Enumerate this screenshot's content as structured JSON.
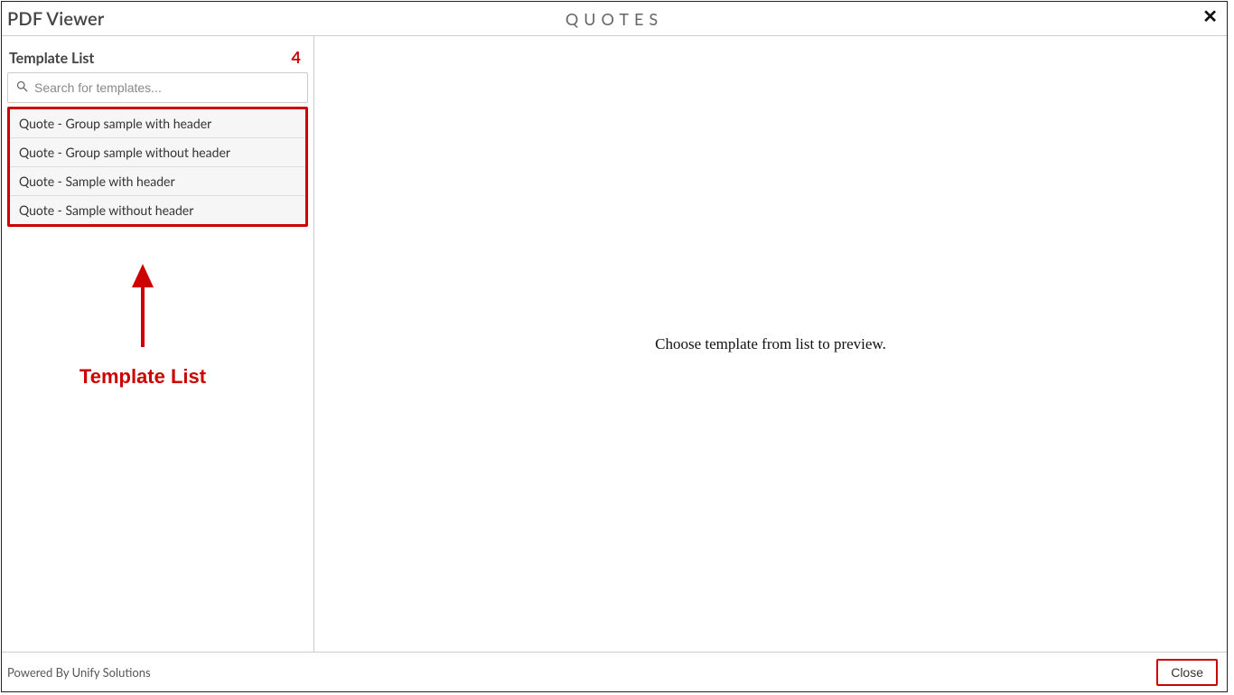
{
  "header": {
    "title": "PDF Viewer",
    "center": "QUOTES"
  },
  "sidebar": {
    "label": "Template List",
    "count": "4",
    "search_placeholder": "Search for templates...",
    "items": [
      "Quote - Group sample with header",
      "Quote - Group sample without header",
      "Quote - Sample with header",
      "Quote - Sample without header"
    ],
    "annotation_label": "Template List"
  },
  "preview": {
    "placeholder": "Choose template from list to preview."
  },
  "footer": {
    "powered": "Powered By Unify Solutions",
    "close_label": "Close"
  }
}
